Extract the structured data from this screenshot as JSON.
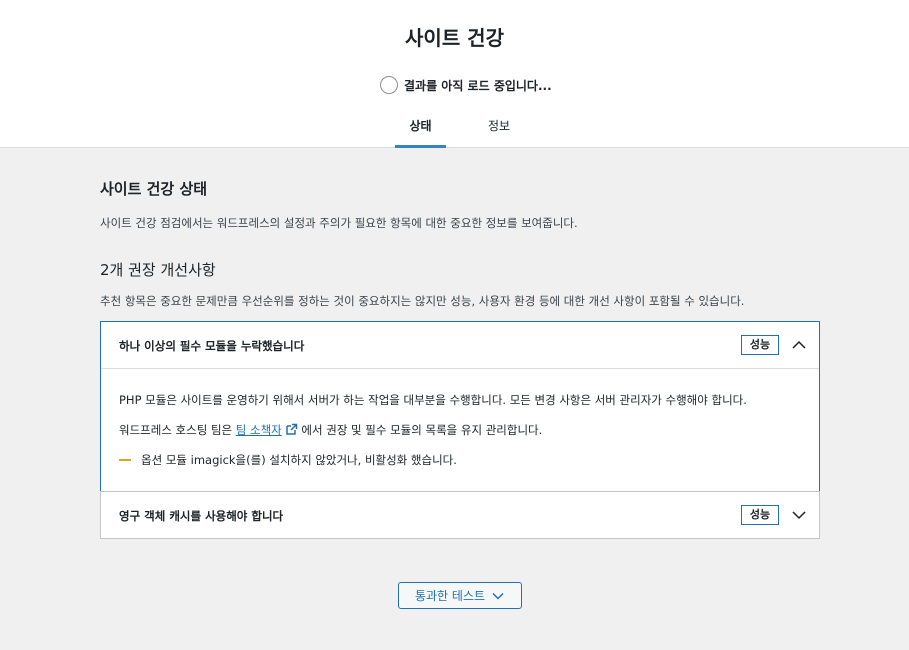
{
  "header": {
    "title": "사이트 건강",
    "progress_text": "결과를 아직 로드 중입니다...",
    "tabs": [
      {
        "label": "상태",
        "active": true
      },
      {
        "label": "정보",
        "active": false
      }
    ]
  },
  "main": {
    "section_title": "사이트 건강 상태",
    "section_desc": "사이트 건강 점검에서는 워드프레스의 설정과 주의가 필요한 항목에 대한 중요한 정보를 보여줍니다.",
    "group_title": "2개 권장 개선사항",
    "group_desc": "추천 항목은 중요한 문제만큼 우선순위를 정하는 것이 중요하지는 않지만 성능, 사용자 환경 등에 대한 개선 사항이 포함될 수 있습니다.",
    "items": [
      {
        "title": "하나 이상의 필수 모듈을 누락했습니다",
        "badge": "성능",
        "expanded": true,
        "body": {
          "line1": "PHP 모듈은 사이트를 운영하기 위해서 서버가 하는 작업을 대부분을 수행합니다. 모든 변경 사항은 서버 관리자가 수행해야 합니다.",
          "line2_prefix": "워드프레스 호스팅 팀은",
          "line2_link": "팀 소책자",
          "line2_suffix": "에서 권장 및 필수 모듈의 목록을 유지 관리합니다.",
          "warning": "옵션 모듈 imagick을(를) 설치하지 않았거나, 비활성화 했습니다."
        }
      },
      {
        "title": "영구 객체 캐시를 사용해야 합니다",
        "badge": "성능",
        "expanded": false
      }
    ],
    "passed_tests_button": "통과한 테스트"
  },
  "colors": {
    "accent": "#2271b1",
    "tab_active": "#3582c4",
    "warning": "#dba617",
    "background": "#f0f0f1"
  }
}
